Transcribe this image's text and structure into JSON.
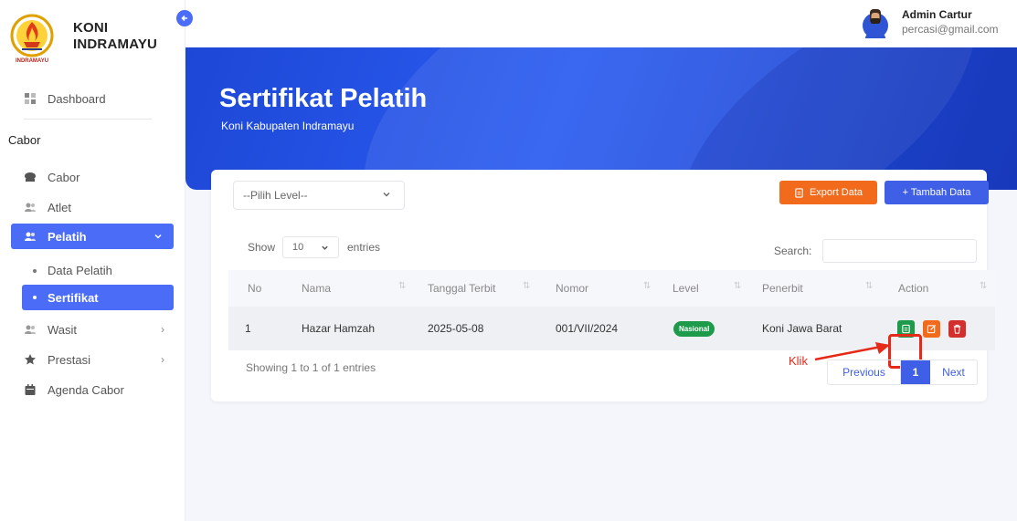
{
  "brand": {
    "line1": "KONI",
    "line2": "INDRAMAYU",
    "logo_text": "INDRAMAYU"
  },
  "user": {
    "name": "Admin Cartur",
    "email": "percasi@gmail.com"
  },
  "sidebar": {
    "dashboard": "Dashboard",
    "section": "Cabor",
    "items": [
      {
        "label": "Cabor"
      },
      {
        "label": "Atlet"
      },
      {
        "label": "Pelatih"
      },
      {
        "label": "Wasit"
      },
      {
        "label": "Prestasi"
      },
      {
        "label": "Agenda Cabor"
      }
    ],
    "subitems": [
      {
        "label": "Data Pelatih"
      },
      {
        "label": "Sertifikat"
      }
    ],
    "chevron_right": "›"
  },
  "page": {
    "title": "Sertifikat Pelatih",
    "subtitle": "Koni Kabupaten Indramayu"
  },
  "filter": {
    "level_placeholder": "--Pilih Level--"
  },
  "buttons": {
    "export": "Export Data",
    "add": "+ Tambah Data"
  },
  "table_controls": {
    "show": "Show",
    "page_size": "10",
    "entries": "entries",
    "search_label": "Search:",
    "search_value": ""
  },
  "table": {
    "columns": [
      "No",
      "Nama",
      "Tanggal Terbit",
      "Nomor",
      "Level",
      "Penerbit",
      "Action"
    ],
    "rows": [
      {
        "no": "1",
        "nama": "Hazar Hamzah",
        "tanggal": "2025-05-08",
        "nomor": "001/VII/2024",
        "level": "Nasional",
        "penerbit": "Koni Jawa Barat"
      }
    ]
  },
  "footer": {
    "info": "Showing 1 to 1 of 1 entries",
    "prev": "Previous",
    "page": "1",
    "next": "Next"
  },
  "annotation": {
    "label": "Klik"
  },
  "colors": {
    "primary": "#4a6cf7",
    "export": "#f26b1d",
    "success": "#1e9b4a",
    "danger": "#d32f2f",
    "annotation": "#e52a1a"
  }
}
